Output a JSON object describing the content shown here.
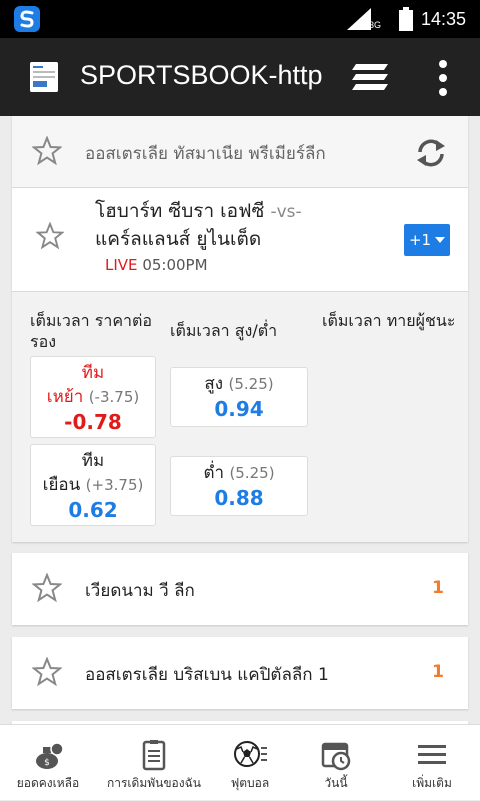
{
  "status_bar": {
    "time": "14:35",
    "network": "3G",
    "icons": [
      "app-s-logo-icon",
      "signal-icon",
      "battery-icon"
    ]
  },
  "app_bar": {
    "title": "SPORTSBOOK-http",
    "icons": [
      "page-icon",
      "layers-icon",
      "more-vert-icon"
    ]
  },
  "league_header": {
    "name": "ออสเตรเลีย ทัสมาเนีย พรีเมียร์ลีก",
    "icons": [
      "star-icon",
      "refresh-icon"
    ]
  },
  "match": {
    "home_team": "โฮบาร์ท ซีบรา เอฟซี",
    "vs": "-vs-",
    "away_team": "แคร์ลแลนส์ ยูไนเต็ด",
    "live_label": "LIVE",
    "kickoff_time": "05:00PM",
    "more_markets_label": "+1"
  },
  "markets": {
    "handicap": {
      "title": "เต็มเวลา ราคาต่อรอง",
      "home": {
        "label_line1": "ทีม",
        "label_line2": "เหย้า",
        "handicap": "(-3.75)",
        "price": "-0.78"
      },
      "away": {
        "label_line1": "ทีม",
        "label_line2": "เยือน",
        "handicap": "(+3.75)",
        "price": "0.62"
      }
    },
    "over_under": {
      "title": "เต็มเวลา สูง/ต่ำ",
      "over": {
        "label": "สูง",
        "line": "(5.25)",
        "price": "0.94"
      },
      "under": {
        "label": "ต่ำ",
        "line": "(5.25)",
        "price": "0.88"
      }
    },
    "winner": {
      "title": "เต็มเวลา ทายผู้ชนะ"
    }
  },
  "leagues": [
    {
      "name": "เวียดนาม วี ลีก",
      "count": "1"
    },
    {
      "name": "ออสเตรเลีย บริสเบน แคปิตัลลีก 1",
      "count": "1"
    }
  ],
  "bottom_nav": [
    {
      "label": "ยอดคงเหลือ",
      "icon": "balance-icon"
    },
    {
      "label": "การเดิมพันของฉัน",
      "icon": "bet-slip-icon"
    },
    {
      "label": "ฟุตบอล",
      "icon": "soccer-ball-icon"
    },
    {
      "label": "วันนี้",
      "icon": "calendar-clock-icon"
    },
    {
      "label": "เพิ่มเติม",
      "icon": "menu-icon"
    }
  ],
  "colors": {
    "accent_blue": "#1e7de4",
    "live_red": "#e01b1b",
    "count_orange": "#f07b2c",
    "app_bar": "#222222"
  }
}
